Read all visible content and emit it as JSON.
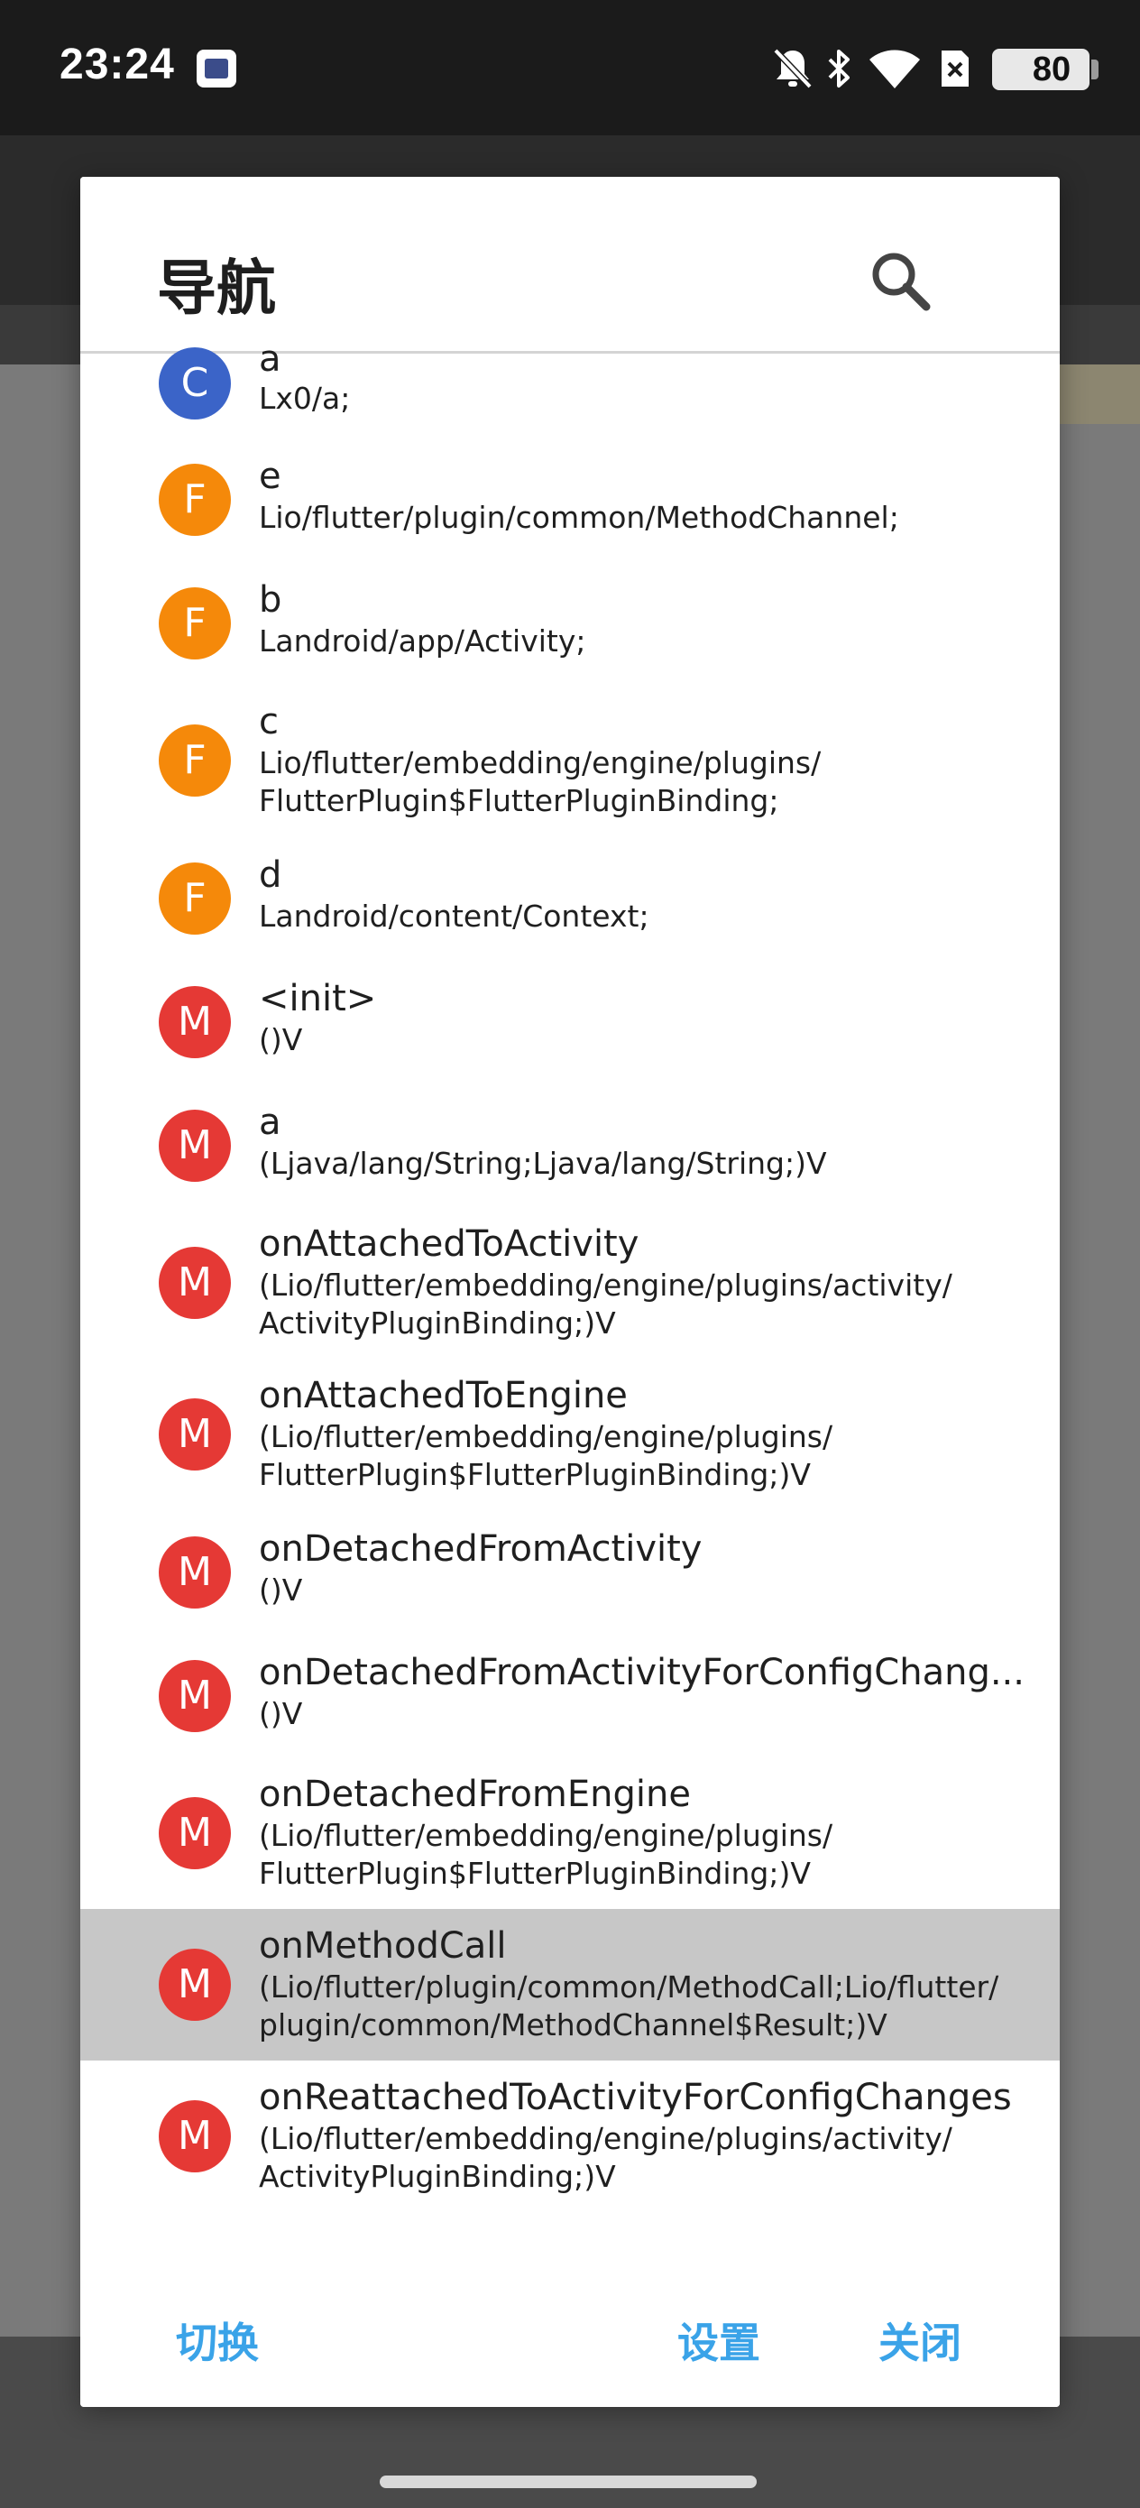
{
  "status_bar": {
    "time": "23:24",
    "app_badge": "MT",
    "icons": [
      "bell-off-icon",
      "bluetooth-icon",
      "wifi-icon",
      "sim-off-icon"
    ],
    "battery": "80"
  },
  "dialog": {
    "title": "导航",
    "search_icon": "search-icon",
    "items": [
      {
        "kind": "C",
        "color": "#3b64c8",
        "name": "a",
        "sig": "Lx0/a;"
      },
      {
        "kind": "F",
        "color": "#f5890a",
        "name": "e",
        "sig": "Lio/flutter/plugin/common/MethodChannel;"
      },
      {
        "kind": "F",
        "color": "#f5890a",
        "name": "b",
        "sig": "Landroid/app/Activity;"
      },
      {
        "kind": "F",
        "color": "#f5890a",
        "name": "c",
        "sig": "Lio/flutter/embedding/engine/plugins/\nFlutterPlugin$FlutterPluginBinding;"
      },
      {
        "kind": "F",
        "color": "#f5890a",
        "name": "d",
        "sig": "Landroid/content/Context;"
      },
      {
        "kind": "M",
        "color": "#e53935",
        "name": "<init>",
        "sig": "()V"
      },
      {
        "kind": "M",
        "color": "#e53935",
        "name": "a",
        "sig": "(Ljava/lang/String;Ljava/lang/String;)V"
      },
      {
        "kind": "M",
        "color": "#e53935",
        "name": "onAttachedToActivity",
        "sig": "(Lio/flutter/embedding/engine/plugins/activity/\nActivityPluginBinding;)V"
      },
      {
        "kind": "M",
        "color": "#e53935",
        "name": "onAttachedToEngine",
        "sig": "(Lio/flutter/embedding/engine/plugins/\nFlutterPlugin$FlutterPluginBinding;)V"
      },
      {
        "kind": "M",
        "color": "#e53935",
        "name": "onDetachedFromActivity",
        "sig": "()V"
      },
      {
        "kind": "M",
        "color": "#e53935",
        "name": "onDetachedFromActivityForConfigChang...",
        "sig": "()V"
      },
      {
        "kind": "M",
        "color": "#e53935",
        "name": "onDetachedFromEngine",
        "sig": "(Lio/flutter/embedding/engine/plugins/\nFlutterPlugin$FlutterPluginBinding;)V"
      },
      {
        "kind": "M",
        "color": "#e53935",
        "name": "onMethodCall",
        "sig": "(Lio/flutter/plugin/common/MethodCall;Lio/flutter/\nplugin/common/MethodChannel$Result;)V",
        "selected": true
      },
      {
        "kind": "M",
        "color": "#e53935",
        "name": "onReattachedToActivityForConfigChanges",
        "sig": "(Lio/flutter/embedding/engine/plugins/activity/\nActivityPluginBinding;)V"
      }
    ],
    "actions": {
      "switch": "切换",
      "settings": "设置",
      "close": "关闭"
    },
    "accent_color": "#3aa3e8"
  }
}
